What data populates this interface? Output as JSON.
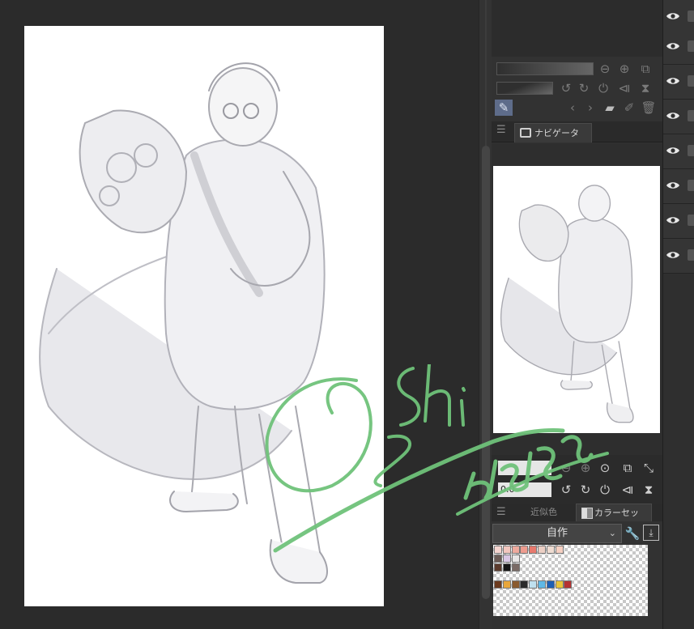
{
  "canvas": {
    "artwork": "Artwork canvas"
  },
  "navigator": {
    "tab_label": "ナビゲーター",
    "zoom_value": "",
    "rotate_value": "0.0"
  },
  "color_panel": {
    "tab_similar": "近似色",
    "tab_colorset": "カラーセット",
    "set_name": "自作"
  },
  "layers": {
    "count": 8
  },
  "icons": {
    "visibility": "eye-icon",
    "menu": "menu-icon",
    "navigator": "navigator-icon",
    "wrench": "wrench-icon",
    "import": "import-icon"
  },
  "swatches": [
    [
      "#f4d4cf",
      "#f3c7bf",
      "#eeaa9e",
      "#ee9c8f",
      "#e87a6e",
      "#eccfc4",
      "#efdcd1",
      "#f6d0c2"
    ],
    [
      "#6a5a55",
      "#d9c7e4",
      "#e8e6e6"
    ],
    [
      "#5b3a2c",
      "#151515",
      "#7a6a65"
    ],
    [],
    [
      "#6b3a1e",
      "#e8a63a",
      "#8a5a2e",
      "#2a2a2a",
      "#bfe0ef",
      "#5fb8e6",
      "#1d5fb5",
      "#e8c43a",
      "#b53232"
    ]
  ],
  "colors": {
    "accent_tab": "#3a3a3a",
    "signature": "#6fc27a"
  }
}
